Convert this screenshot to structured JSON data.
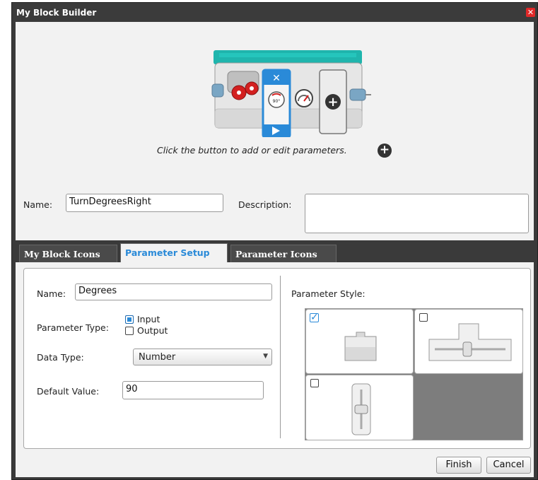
{
  "window": {
    "title": "My Block Builder",
    "close_glyph": "✕"
  },
  "preview": {
    "caption": "Click the button to add or edit parameters.",
    "add_glyph": "+",
    "parameter_icon_label": "90°"
  },
  "name": {
    "label": "Name:",
    "value": "TurnDegreesRight"
  },
  "description": {
    "label": "Description:",
    "value": ""
  },
  "tabs": [
    {
      "label": "My Block Icons",
      "active": false
    },
    {
      "label": "Parameter Setup",
      "active": true
    },
    {
      "label": "Parameter Icons",
      "active": false
    }
  ],
  "parameter_setup": {
    "name_label": "Name:",
    "name_value": "Degrees",
    "type_label": "Parameter Type:",
    "input_label": "Input",
    "output_label": "Output",
    "input_checked": true,
    "output_checked": false,
    "data_type_label": "Data Type:",
    "data_type_value": "Number",
    "default_label": "Default Value:",
    "default_value": "90",
    "style_label": "Parameter Style:"
  },
  "buttons": {
    "finish": "Finish",
    "cancel": "Cancel"
  },
  "colors": {
    "accent": "#2a8ad8",
    "block_teal": "#1fb5ad",
    "motor_red": "#d32020",
    "chrome_dark": "#3a3a3a"
  }
}
